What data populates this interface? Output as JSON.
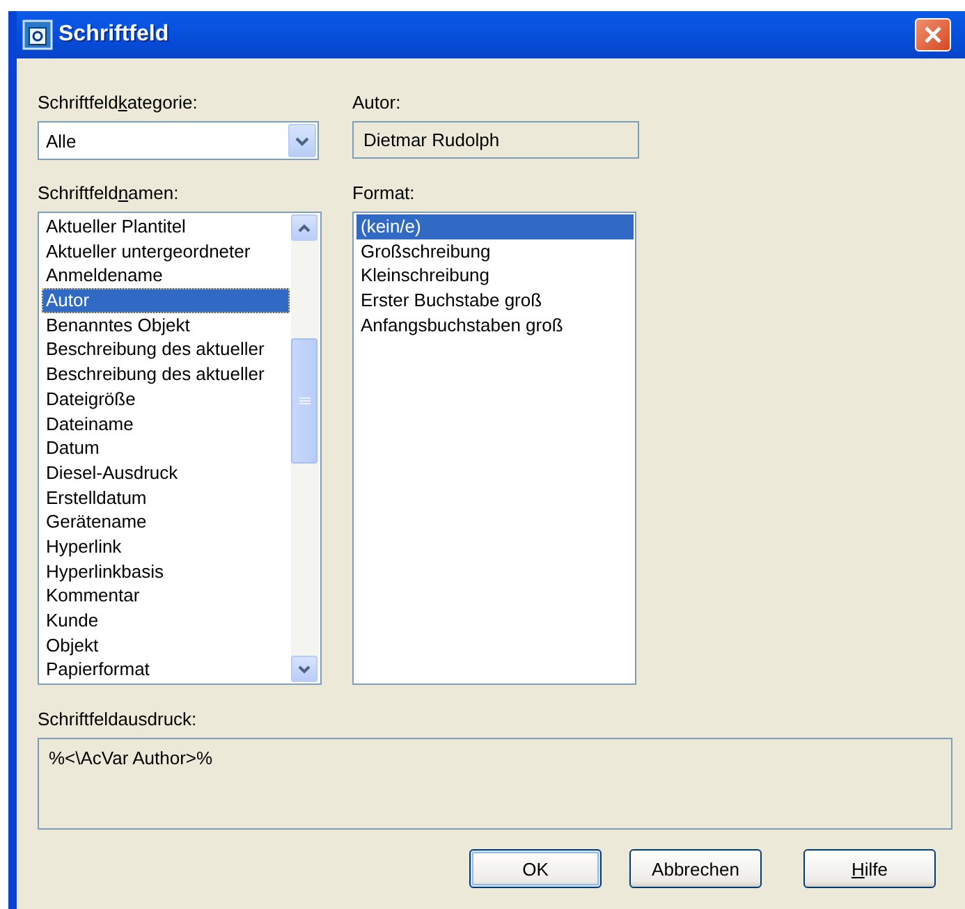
{
  "window": {
    "title": "Schriftfeld"
  },
  "category": {
    "label": {
      "before": "Schriftfeld",
      "access_key": "k",
      "after": "ategorie:"
    },
    "value": "Alle"
  },
  "author": {
    "label": {
      "before": "Autor:"
    },
    "value": "Dietmar Rudolph"
  },
  "field_names": {
    "label": {
      "before": "Schriftfeld",
      "access_key": "n",
      "after": "amen:"
    },
    "items": [
      {
        "text": "Aktueller Plantitel",
        "selected": false
      },
      {
        "text": "Aktueller untergeordneter",
        "selected": false
      },
      {
        "text": "Anmeldename",
        "selected": false
      },
      {
        "text": "Autor",
        "selected": true
      },
      {
        "text": "Benanntes Objekt",
        "selected": false
      },
      {
        "text": "Beschreibung des aktueller",
        "selected": false
      },
      {
        "text": "Beschreibung des aktueller",
        "selected": false
      },
      {
        "text": "Dateigröße",
        "selected": false
      },
      {
        "text": "Dateiname",
        "selected": false
      },
      {
        "text": "Datum",
        "selected": false
      },
      {
        "text": "Diesel-Ausdruck",
        "selected": false
      },
      {
        "text": "Erstelldatum",
        "selected": false
      },
      {
        "text": "Gerätename",
        "selected": false
      },
      {
        "text": "Hyperlink",
        "selected": false
      },
      {
        "text": "Hyperlinkbasis",
        "selected": false
      },
      {
        "text": "Kommentar",
        "selected": false
      },
      {
        "text": "Kunde",
        "selected": false
      },
      {
        "text": "Objekt",
        "selected": false
      },
      {
        "text": "Papierformat",
        "selected": false
      }
    ]
  },
  "format": {
    "label": {
      "before": "Format:"
    },
    "items": [
      {
        "text": "(kein/e)",
        "selected": true
      },
      {
        "text": "Großschreibung",
        "selected": false
      },
      {
        "text": "Kleinschreibung",
        "selected": false
      },
      {
        "text": "Erster Buchstabe groß",
        "selected": false
      },
      {
        "text": "Anfangsbuchstaben groß",
        "selected": false
      }
    ]
  },
  "expression": {
    "label": {
      "before": "Schriftfeldausdruck:"
    },
    "value": "%<\\AcVar Author>%"
  },
  "buttons": [
    {
      "label": {
        "before": "OK"
      },
      "default": true
    },
    {
      "label": {
        "before": "Abbrechen"
      },
      "default": false
    },
    {
      "label": {
        "access_key": "H",
        "after": "ilfe"
      },
      "default": false
    }
  ]
}
